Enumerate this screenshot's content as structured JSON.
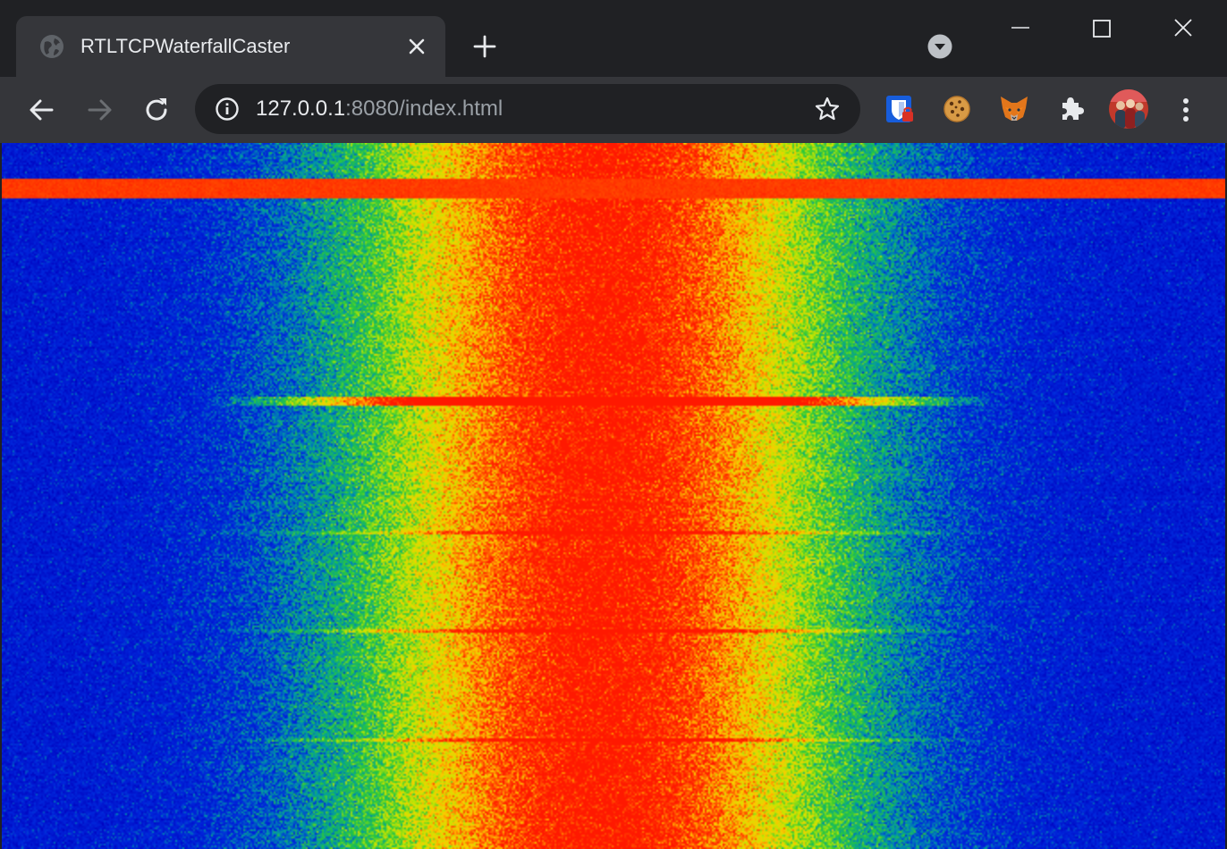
{
  "window": {
    "tab": {
      "title": "RTLTCPWaterfallCaster",
      "favicon": "globe-icon"
    },
    "controls": [
      "minimize-icon",
      "maximize-icon",
      "close-icon"
    ]
  },
  "toolbar": {
    "back_icon": "back-arrow-icon",
    "forward_icon": "forward-arrow-icon",
    "reload_icon": "reload-icon",
    "address": {
      "host": "127.0.0.1",
      "rest": ":8080/index.html"
    },
    "extensions": [
      "bitwarden-icon",
      "cookie-icon",
      "metamask-fox-icon",
      "puzzle-extensions-icon"
    ],
    "profile": "profile-avatar"
  },
  "colors": {
    "frame": "#202124",
    "toolbar": "#35363a",
    "low": "#0000c8",
    "mid": "#00c060",
    "high": "#ffff00",
    "peak": "#ff2000"
  }
}
